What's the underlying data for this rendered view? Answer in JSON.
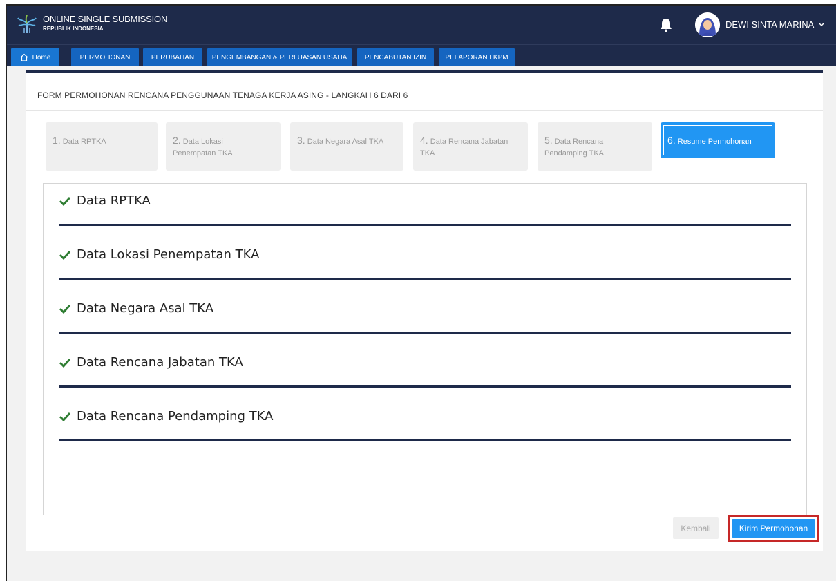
{
  "header": {
    "brand_title": "ONLINE SINGLE SUBMISSION",
    "brand_subtitle": "REPUBLIK INDONESIA",
    "logo_icon": "oss-tree-logo",
    "notification_icon": "bell-icon",
    "user_name": "DEWI SINTA MARINA",
    "user_menu_icon": "chevron-down-icon"
  },
  "nav": {
    "home": "Home",
    "items": [
      "PERMOHONAN",
      "PERUBAHAN",
      "PENGEMBANGAN & PERLUASAN USAHA",
      "PENCABUTAN IZIN",
      "PELAPORAN LKPM"
    ]
  },
  "form": {
    "title": "FORM PERMOHONAN RENCANA PENGGUNAAN TENAGA KERJA ASING - LANGKAH 6 DARI 6",
    "steps": [
      {
        "num": "1.",
        "label": "Data RPTKA"
      },
      {
        "num": "2.",
        "label": "Data Lokasi Penempatan TKA"
      },
      {
        "num": "3.",
        "label": "Data Negara Asal TKA"
      },
      {
        "num": "4.",
        "label": "Data Rencana Jabatan TKA"
      },
      {
        "num": "5.",
        "label": "Data Rencana Pendamping TKA"
      },
      {
        "num": "6.",
        "label": "Resume Permohonan"
      }
    ],
    "active_step": 6,
    "sections": [
      "Data RPTKA",
      "Data Lokasi Penempatan TKA",
      "Data Negara Asal TKA",
      "Data Rencana Jabatan TKA",
      "Data Rencana Pendamping TKA"
    ],
    "back_label": "Kembali",
    "submit_label": "Kirim Permohonan"
  },
  "colors": {
    "header_bg": "#1e2a4a",
    "nav_button": "#1565c0",
    "accent": "#2196f3",
    "check": "#2e7d32",
    "highlight_border": "#c62828"
  }
}
